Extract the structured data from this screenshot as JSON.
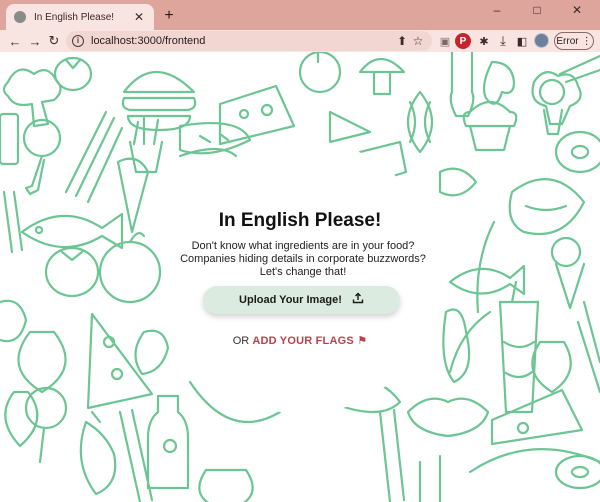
{
  "browser": {
    "tab": {
      "title": "In English Please!",
      "close_glyph": "✕"
    },
    "new_tab_glyph": "+",
    "window_controls": {
      "minimize": "–",
      "maximize": "□",
      "close": "✕"
    },
    "toolbar": {
      "back_glyph": "←",
      "forward_glyph": "→",
      "reload_glyph": "↻",
      "url": "localhost:3000/frontend",
      "info_glyph": "i",
      "share_glyph": "⬆",
      "star_glyph": "☆",
      "error_button": "Error",
      "menu_glyph": "⋮"
    },
    "extensions": [
      {
        "name": "extension-icon",
        "glyph": "▣",
        "color": "#7a6a68"
      },
      {
        "name": "pinterest-icon",
        "glyph": "P",
        "color": "#c8232c"
      },
      {
        "name": "puzzle-icon",
        "glyph": "✱",
        "color": "#3a2a28"
      },
      {
        "name": "download-icon",
        "glyph": "⤓",
        "color": "#3a2a28"
      },
      {
        "name": "sidepanel-icon",
        "glyph": "◧",
        "color": "#3a2a28"
      }
    ]
  },
  "page": {
    "heading": "In English Please!",
    "description": "Don't know what ingredients are in your food? Companies hiding details in corporate buzzwords? Let's change that!",
    "upload_label": "Upload Your Image!",
    "upload_icon": "⭱",
    "or_text": "OR",
    "flags_link": "ADD YOUR FLAGS",
    "flag_glyph": "⚑"
  },
  "colors": {
    "tab_strip": "#dea59d",
    "toolbar": "#f8e4e1",
    "doodle_stroke": "#6cc593",
    "upload_bg": "#dcebe0",
    "link": "#b8434b"
  }
}
